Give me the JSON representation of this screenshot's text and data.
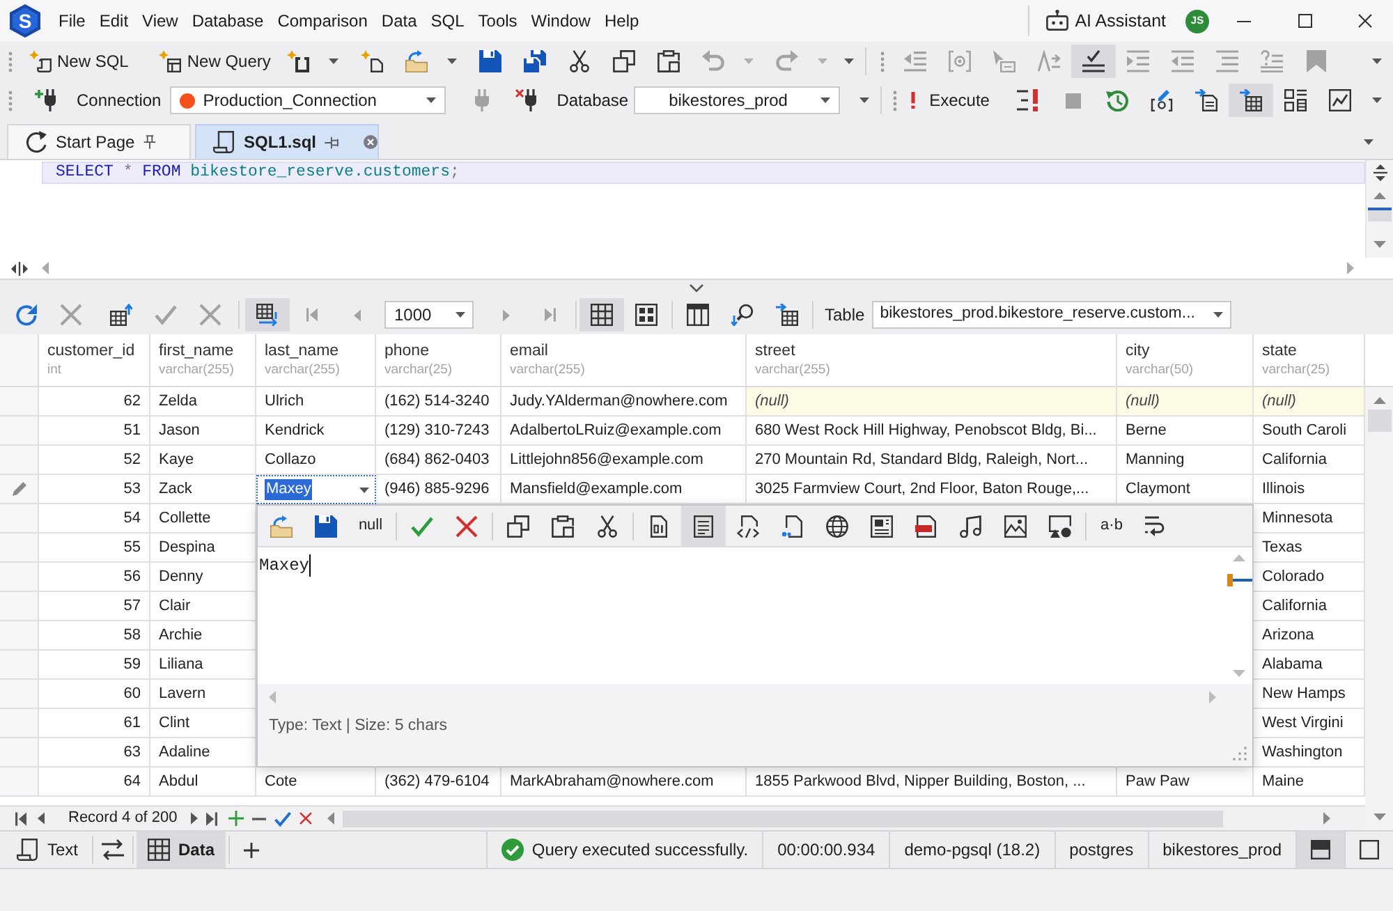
{
  "menu_bar": {
    "logo": "S",
    "menus": [
      "File",
      "Edit",
      "View",
      "Database",
      "Comparison",
      "Data",
      "SQL",
      "Tools",
      "Window",
      "Help"
    ],
    "ai_assistant": "AI Assistant",
    "avatar": "JS"
  },
  "main_toolbar": {
    "new_sql": "New SQL",
    "new_query": "New Query",
    "buttons": [
      {
        "disabled": false,
        "selected": false
      },
      {
        "disabled": false,
        "selected": false
      },
      {
        "disabled": false,
        "selected": false
      },
      {
        "disabled": false,
        "selected": false
      },
      {
        "disabled": false,
        "selected": false
      },
      {
        "disabled": false,
        "selected": false
      },
      {
        "disabled": false,
        "selected": false
      },
      {
        "disabled": false,
        "selected": false
      },
      {
        "disabled": true,
        "selected": false
      },
      {
        "disabled": true,
        "selected": false
      },
      {
        "disabled": true,
        "selected": false
      },
      {
        "disabled": true,
        "selected": false
      },
      {
        "disabled": true,
        "selected": false
      },
      {
        "disabled": true,
        "selected": false
      },
      {
        "disabled": false,
        "selected": true
      },
      {
        "disabled": true,
        "selected": false
      },
      {
        "disabled": true,
        "selected": false
      },
      {
        "disabled": true,
        "selected": false
      },
      {
        "disabled": true,
        "selected": false
      },
      {
        "disabled": true,
        "selected": false
      }
    ]
  },
  "connection_toolbar": {
    "connection_label": "Connection",
    "connection": "Production_Connection",
    "database_label": "Database",
    "database": "bikestores_prod",
    "execute": "Execute",
    "buttons": [
      {
        "disabled": false,
        "selected": false
      },
      {
        "disabled": true,
        "selected": false
      },
      {
        "disabled": false,
        "selected": false
      },
      {
        "disabled": false,
        "selected": false
      },
      {
        "disabled": true,
        "selected": false
      },
      {
        "disabled": false,
        "selected": false
      },
      {
        "disabled": false,
        "selected": false
      },
      {
        "disabled": false,
        "selected": false
      },
      {
        "disabled": false,
        "selected": true
      },
      {
        "disabled": false,
        "selected": false
      },
      {
        "disabled": false,
        "selected": false
      }
    ]
  },
  "document_tabs": [
    {
      "label": "Start Page",
      "kind": "start_page",
      "selected": false,
      "pinned": true
    },
    {
      "label": "SQL1.sql",
      "kind": "sql_file",
      "selected": true,
      "pinned": false
    }
  ],
  "editor": {
    "lines": [
      {
        "current": true,
        "tokens": [
          {
            "text": "SELECT ",
            "kind": "keyword"
          },
          {
            "text": "* ",
            "kind": "operator"
          },
          {
            "text": "FROM ",
            "kind": "keyword"
          },
          {
            "text": "bikestore_reserve.customers",
            "kind": "identifier"
          },
          {
            "text": ";",
            "kind": "operator"
          }
        ]
      }
    ]
  },
  "results_toolbar": {
    "buttons": [
      {
        "disabled": false,
        "selected": false
      },
      {
        "disabled": true,
        "selected": false
      },
      {
        "disabled": false,
        "selected": false
      },
      {
        "disabled": true,
        "selected": false
      },
      {
        "disabled": true,
        "selected": false
      },
      {
        "disabled": false,
        "selected": true
      },
      {
        "disabled": true,
        "selected": false
      },
      {
        "disabled": true,
        "selected": false
      },
      {
        "disabled": true,
        "selected": false
      },
      {
        "disabled": true,
        "selected": false
      },
      {
        "disabled": false,
        "selected": true
      },
      {
        "disabled": false,
        "selected": false
      },
      {
        "disabled": false,
        "selected": false
      },
      {
        "disabled": false,
        "selected": false
      },
      {
        "disabled": false,
        "selected": false
      }
    ],
    "page_size": "1000",
    "table_label": "Table",
    "table": "bikestores_prod.bikestore_reserve.custom..."
  },
  "grid": {
    "columns": [
      {
        "name": "customer_id",
        "type": "int",
        "kind": "number"
      },
      {
        "name": "first_name",
        "type": "varchar(255)",
        "kind": "text"
      },
      {
        "name": "last_name",
        "type": "varchar(255)",
        "kind": "text"
      },
      {
        "name": "phone",
        "type": "varchar(25)",
        "kind": "text"
      },
      {
        "name": "email",
        "type": "varchar(255)",
        "kind": "text"
      },
      {
        "name": "street",
        "type": "varchar(255)",
        "kind": "text"
      },
      {
        "name": "city",
        "type": "varchar(50)",
        "kind": "text"
      },
      {
        "name": "state",
        "type": "varchar(25)",
        "kind": "text"
      }
    ],
    "rows": [
      {
        "edited": false,
        "cells": [
          "62",
          "Zelda",
          "Ulrich",
          "(162) 514-3240",
          "Judy.YAlderman@nowhere.com",
          {
            "text": "(null)",
            "kind": "null"
          },
          {
            "text": "(null)",
            "kind": "null"
          },
          {
            "text": "(null)",
            "kind": "null"
          }
        ]
      },
      {
        "edited": false,
        "cells": [
          "51",
          "Jason",
          "Kendrick",
          "(129) 310-7243",
          "AdalbertoLRuiz@example.com",
          "680 West Rock Hill Highway, Penobscot Bldg, Bi...",
          "Berne",
          "South Caroli"
        ]
      },
      {
        "edited": false,
        "cells": [
          "52",
          "Kaye",
          "Collazo",
          "(684) 862-0403",
          "Littlejohn856@example.com",
          "270 Mountain Rd, Standard Bldg, Raleigh, Nort...",
          "Manning",
          "California"
        ]
      },
      {
        "edited": true,
        "cells": [
          "53",
          "Zack",
          {
            "text": "Maxey",
            "kind": "editing"
          },
          "(946) 885-9296",
          "Mansfield@example.com",
          "3025 Farmview Court, 2nd Floor, Baton Rouge,...",
          "Claymont",
          "Illinois"
        ]
      },
      {
        "edited": false,
        "cells": [
          "54",
          "Collette",
          null,
          null,
          null,
          null,
          null,
          "Minnesota"
        ]
      },
      {
        "edited": false,
        "cells": [
          "55",
          "Despina",
          null,
          null,
          null,
          null,
          null,
          "Texas"
        ]
      },
      {
        "edited": false,
        "cells": [
          "56",
          "Denny",
          null,
          null,
          null,
          null,
          null,
          "Colorado"
        ]
      },
      {
        "edited": false,
        "cells": [
          "57",
          "Clair",
          null,
          null,
          null,
          null,
          null,
          "California"
        ]
      },
      {
        "edited": false,
        "cells": [
          "58",
          "Archie",
          null,
          null,
          null,
          null,
          null,
          "Arizona"
        ]
      },
      {
        "edited": false,
        "cells": [
          "59",
          "Liliana",
          null,
          null,
          null,
          null,
          null,
          "Alabama"
        ]
      },
      {
        "edited": false,
        "cells": [
          "60",
          "Lavern",
          null,
          null,
          null,
          null,
          null,
          "New Hamps"
        ]
      },
      {
        "edited": false,
        "cells": [
          "61",
          "Clint",
          null,
          null,
          null,
          null,
          null,
          "West Virgini"
        ]
      },
      {
        "edited": false,
        "cells": [
          "63",
          "Adaline",
          null,
          null,
          null,
          null,
          null,
          "Washington"
        ]
      },
      {
        "edited": false,
        "cells": [
          "64",
          "Abdul",
          "Cote",
          "(362) 479-6104",
          "MarkAbraham@nowhere.com",
          "1855 Parkwood Blvd, Nipper Building, Boston, ...",
          "Paw Paw",
          "Maine"
        ]
      }
    ]
  },
  "value_editor": {
    "null_button": "null",
    "views": [
      {
        "selected": false
      },
      {
        "selected": true
      },
      {
        "selected": false
      },
      {
        "selected": false
      },
      {
        "selected": false
      },
      {
        "selected": false
      },
      {
        "selected": false
      },
      {
        "selected": false
      },
      {
        "selected": false
      },
      {
        "selected": false
      }
    ],
    "whitespace_button": "a·b",
    "text": "Maxey",
    "info": "Type: Text | Size: 5 chars"
  },
  "record_navigator": {
    "position": "Record 4 of 200"
  },
  "status_bar": {
    "views": [
      {
        "label": "Text",
        "kind": "text",
        "selected": false
      },
      {
        "label": "Data",
        "kind": "data",
        "selected": true
      }
    ],
    "message": "Query executed successfully.",
    "fields": [
      "00:00:00.934",
      "demo-pgsql (18.2)",
      "postgres",
      "bikestores_prod"
    ],
    "layouts": [
      {
        "kind": "split",
        "selected": true
      },
      {
        "kind": "single",
        "selected": false
      }
    ]
  }
}
